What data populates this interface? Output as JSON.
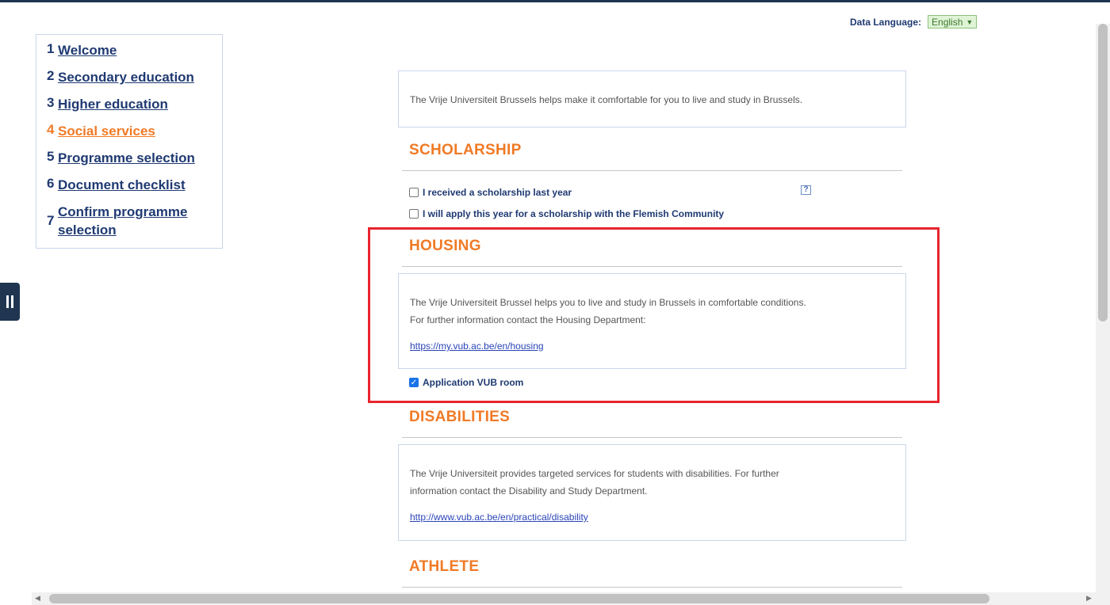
{
  "header": {
    "data_language_label": "Data Language:",
    "data_language_value": "English"
  },
  "steps": [
    {
      "num": "1",
      "label": "Welcome"
    },
    {
      "num": "2",
      "label": "Secondary education"
    },
    {
      "num": "3",
      "label": "Higher education"
    },
    {
      "num": "4",
      "label": "Social services",
      "active": true
    },
    {
      "num": "5",
      "label": "Programme selection"
    },
    {
      "num": "6",
      "label": "Document checklist"
    },
    {
      "num": "7",
      "label_line1": "Confirm programme",
      "label_line2": "selection"
    }
  ],
  "intro": {
    "text": "The Vrije Universiteit Brussels helps make it comfortable for you to live and study in Brussels."
  },
  "scholarship": {
    "title": "SCHOLARSHIP",
    "options": [
      {
        "label": "I received a scholarship last year",
        "checked": false
      },
      {
        "label": "I will apply this year for a scholarship with the Flemish Community",
        "checked": false
      }
    ],
    "help_icon": "?"
  },
  "housing": {
    "title": "HOUSING",
    "text_line1": "The Vrije Universiteit Brussel helps you to live and study in Brussels in comfortable conditions.",
    "text_line2": "For further information contact the Housing Department:",
    "link": "https://my.vub.ac.be/en/housing",
    "option": {
      "label": "Application VUB room",
      "checked": true
    }
  },
  "disabilities": {
    "title": "DISABILITIES",
    "text_line1": "The Vrije Universiteit provides targeted services for students with disabilities. For further",
    "text_line2": "information contact the Disability and Study Department.",
    "link": "http://www.vub.ac.be/en/practical/disability"
  },
  "athlete": {
    "title": "ATHLETE"
  },
  "colors": {
    "accent": "#f07a26",
    "nav": "#1f3a72",
    "highlight": "#e8242e"
  }
}
